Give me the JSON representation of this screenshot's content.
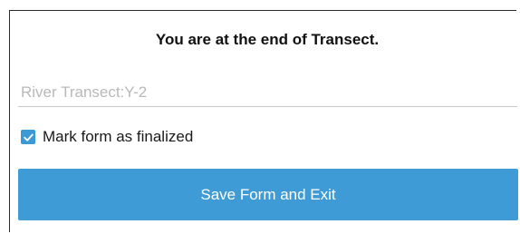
{
  "form_end": {
    "heading": "You are at the end of Transect.",
    "instance_name": {
      "value": "",
      "placeholder": "River Transect:Y-2"
    },
    "finalize": {
      "label": "Mark form as finalized",
      "checked": true
    },
    "save_button_label": "Save Form and Exit"
  },
  "colors": {
    "accent": "#3f9bd6",
    "checkbox": "#3b9ad5",
    "placeholder": "#b9b9b9"
  },
  "icons": {
    "checkbox": "checkmark-icon"
  }
}
